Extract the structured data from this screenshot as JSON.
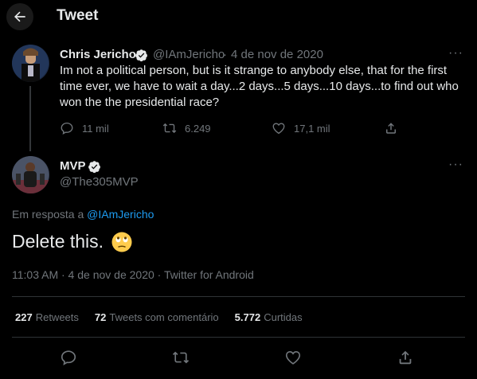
{
  "header": {
    "title": "Tweet"
  },
  "parent_tweet": {
    "name": "Chris Jericho",
    "handle": "@IAmJericho",
    "date": "4 de nov de 2020",
    "dot": "·",
    "text": "Im not a political person, but is it strange to anybody else, that for the first time ever, we have to wait a day...2 days...5 days...10 days...to find out who won the the presidential race?",
    "more": "···",
    "actions": {
      "replies": "11 mil",
      "retweets": "6.249",
      "likes": "17,1 mil"
    }
  },
  "main_tweet": {
    "name": "MVP",
    "handle": "@The305MVP",
    "more": "···",
    "reply_prefix": "Em resposta a",
    "reply_mention": "@IAmJericho",
    "text": "Delete this.",
    "timestamp": "11:03 AM · 4 de nov de 2020 · Twitter for Android",
    "stats": {
      "retweets_count": "227",
      "retweets_label": "Retweets",
      "quotes_count": "72",
      "quotes_label": "Tweets com comentário",
      "likes_count": "5.772",
      "likes_label": "Curtidas"
    }
  },
  "colors": {
    "accent": "#1d9bf0",
    "background": "#000000",
    "muted": "#71767b",
    "text": "#e7e9ea"
  }
}
